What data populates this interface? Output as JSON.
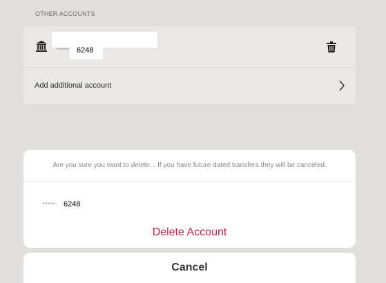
{
  "other_accounts": {
    "heading": "OTHER ACCOUNTS",
    "account": {
      "masked": "*****",
      "last4": "6248"
    },
    "add_label": "Add additional account"
  },
  "delete_sheet": {
    "message": "Are you sure you want to delete... If you have future dated transfers they will be canceled.",
    "account": {
      "masked": "*****·",
      "last4": "6248"
    },
    "delete_label": "Delete Account"
  },
  "cancel_label": "Cancel",
  "colors": {
    "background": "#e1dedb",
    "card": "#e9e8e7",
    "destructive": "#c0234d"
  },
  "icons": {
    "bank": "bank-icon",
    "trash": "trash-icon",
    "chevron": "chevron-right-icon"
  }
}
